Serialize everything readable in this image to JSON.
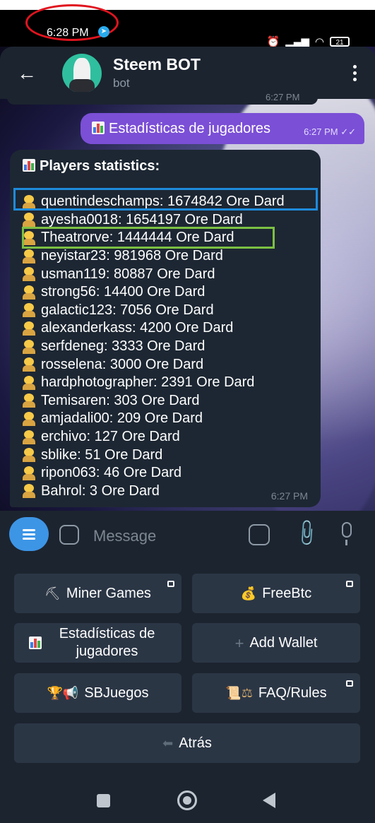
{
  "status_bar": {
    "time": "6:28 PM",
    "battery": "21"
  },
  "header": {
    "title": "Steem BOT",
    "subtitle": "bot"
  },
  "messages": {
    "previous_time": "6:27 PM",
    "outgoing": {
      "text": "Estadísticas de jugadores",
      "time": "6:27 PM"
    },
    "incoming": {
      "title": "Players statistics:",
      "time": "6:27 PM",
      "players": [
        "quentindeschamps: 1674842 Ore Dard",
        "ayesha0018: 1654197 Ore Dard",
        "Theatrorve: 1444444 Ore Dard",
        "neyistar23: 981968 Ore Dard",
        "usman119: 80887 Ore Dard",
        "strong56: 14400 Ore Dard",
        "galactic123: 7056 Ore Dard",
        "alexanderkass: 4200 Ore Dard",
        "serfdeneg: 3333 Ore Dard",
        "rosselena: 3000 Ore Dard",
        "hardphotographer: 2391 Ore Dard",
        "Temisaren: 303 Ore Dard",
        "amjadali00: 209 Ore Dard",
        "erchivo: 127 Ore Dard",
        "sblike: 51 Ore Dard",
        "ripon063: 46 Ore Dard",
        "Bahrol: 3 Ore Dard"
      ]
    }
  },
  "compose": {
    "placeholder": "Message"
  },
  "keyboard": {
    "miner_games": "Miner Games",
    "freebtc": "FreeBtc",
    "estadisticas": "Estadísticas de jugadores",
    "add_wallet": "Add Wallet",
    "sbjuegos": "SBJuegos",
    "faq_rules": "FAQ/Rules",
    "atras": "Atrás"
  },
  "icons": {
    "back": "back-arrow-icon",
    "more": "more-vertical-icon",
    "menu": "menu-icon",
    "sticker": "sticker-icon",
    "commands": "commands-icon",
    "attach": "paperclip-icon",
    "mic": "microphone-icon"
  },
  "colors": {
    "outgoing_bubble": "#7b4fd6",
    "incoming_bubble": "#1d2733",
    "accent": "#3d95e6",
    "highlight_blue": "#1e8bdc",
    "highlight_green": "#7cc043",
    "annotation_red": "#e0141e"
  }
}
